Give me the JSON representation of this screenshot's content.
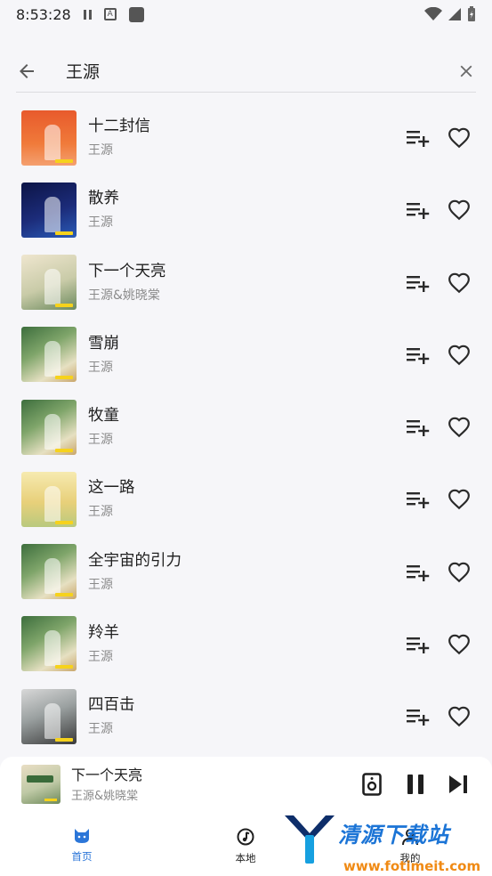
{
  "status_bar": {
    "time": "8:53:28",
    "badge_letter": "A"
  },
  "search": {
    "query": "王源",
    "placeholder": ""
  },
  "songs": [
    {
      "title": "十二封信",
      "artist": "王源",
      "cover": "orange"
    },
    {
      "title": "散养",
      "artist": "王源",
      "cover": "navy"
    },
    {
      "title": "下一个天亮",
      "artist": "王源&姚晓棠",
      "cover": "beige"
    },
    {
      "title": "雪崩",
      "artist": "王源",
      "cover": "green"
    },
    {
      "title": "牧童",
      "artist": "王源",
      "cover": "green"
    },
    {
      "title": "这一路",
      "artist": "王源",
      "cover": "yellow"
    },
    {
      "title": "全宇宙的引力",
      "artist": "王源",
      "cover": "green"
    },
    {
      "title": "羚羊",
      "artist": "王源",
      "cover": "green"
    },
    {
      "title": "四百击",
      "artist": "王源",
      "cover": "photo"
    }
  ],
  "icons": {
    "back": "arrow-left-icon",
    "clear": "close-icon",
    "add_queue": "playlist-add-icon",
    "like": "heart-outline-icon"
  },
  "now_playing": {
    "title": "下一个天亮",
    "artist": "王源&姚晓棠"
  },
  "nav": {
    "home_label": "首页",
    "local_label": "本地",
    "mine_label": "我的"
  },
  "watermark": {
    "title": "清源下载站",
    "url": "www.fotimeit.com"
  },
  "colors": {
    "accent": "#2b76d8",
    "background": "#f6f6f9",
    "text_primary": "#1f1f1f",
    "text_secondary": "#8a8a8a",
    "icon": "#2a2a2a"
  }
}
